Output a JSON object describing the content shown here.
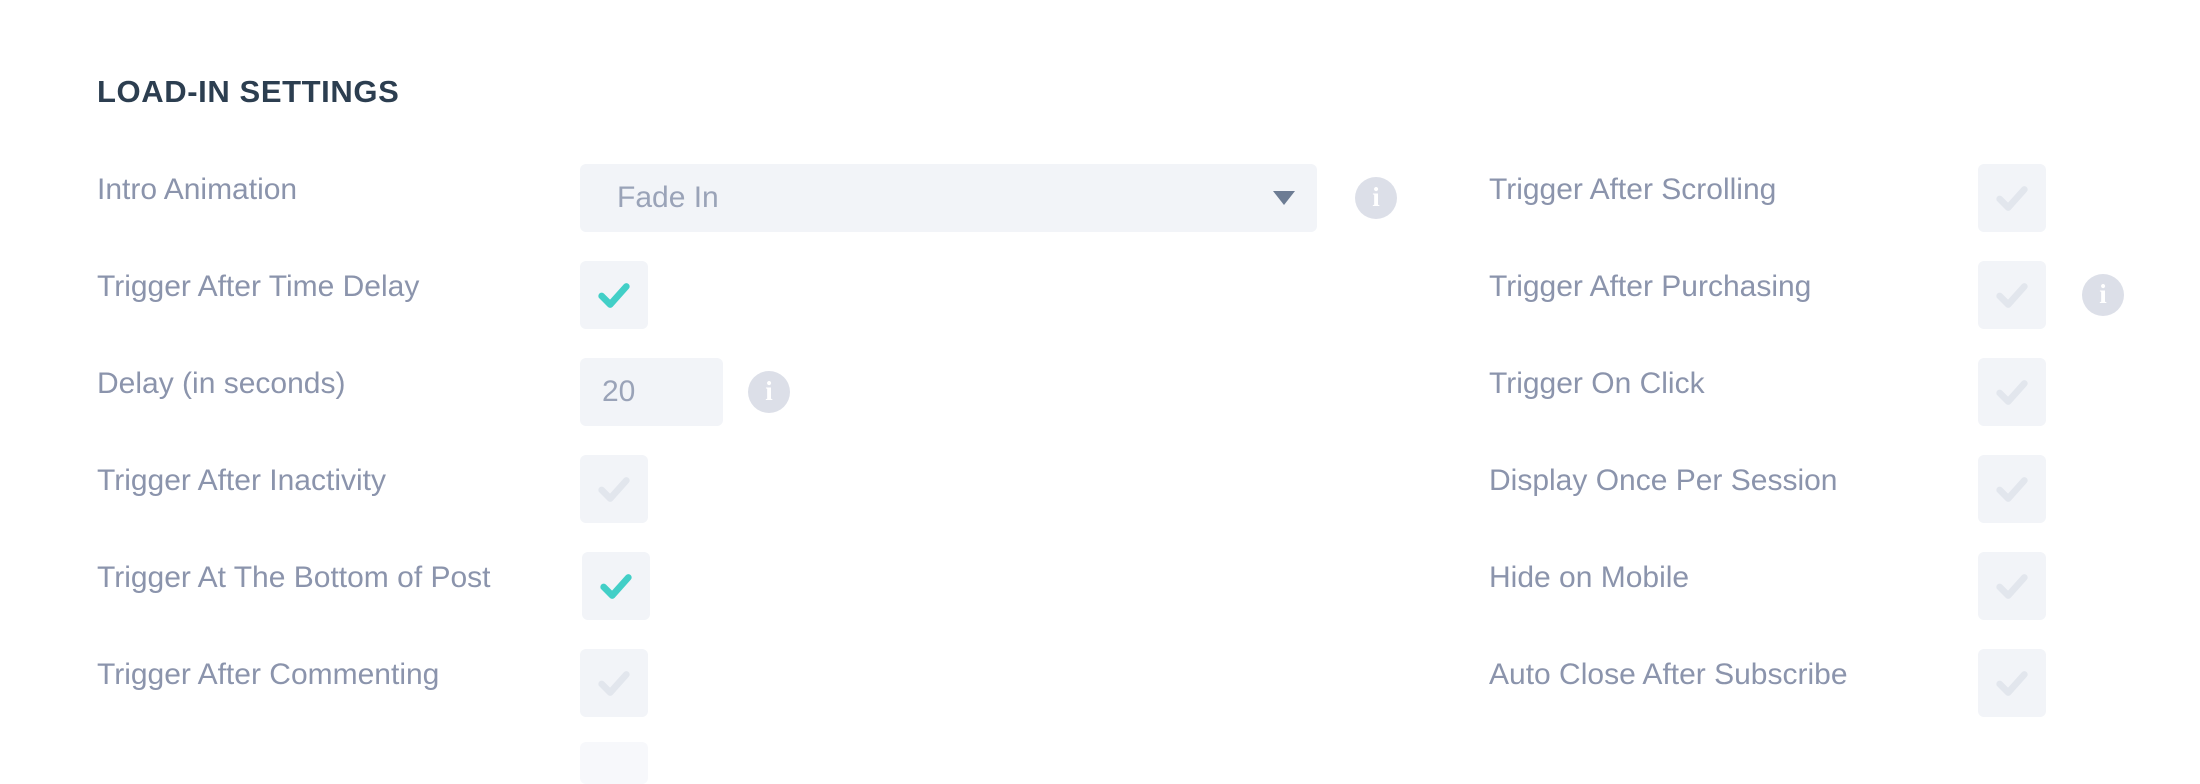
{
  "section": {
    "title": "LOAD-IN SETTINGS"
  },
  "colors": {
    "accent_check": "#42cfc7",
    "inactive_check": "#e2e6ed",
    "control_bg": "#f2f4f8",
    "label_text": "#8b94ac",
    "title_text": "#2c3e50",
    "info_icon_bg": "#dcdfe8"
  },
  "left_column": [
    {
      "label": "Intro Animation",
      "control": "select",
      "value": "Fade In",
      "has_info": true
    },
    {
      "label": "Trigger After Time Delay",
      "control": "checkbox",
      "checked": true,
      "has_info": false
    },
    {
      "label": "Delay (in seconds)",
      "control": "text",
      "value": "20",
      "has_info": true
    },
    {
      "label": "Trigger After Inactivity",
      "control": "checkbox",
      "checked": false,
      "has_info": false
    },
    {
      "label": "Trigger At The Bottom of Post",
      "control": "checkbox",
      "checked": true,
      "has_info": false
    },
    {
      "label": "Trigger After Commenting",
      "control": "checkbox",
      "checked": false,
      "has_info": false
    }
  ],
  "right_column": [
    {
      "label": "Trigger After Scrolling",
      "control": "checkbox",
      "checked": false,
      "has_info": false
    },
    {
      "label": "Trigger After Purchasing",
      "control": "checkbox",
      "checked": false,
      "has_info": true
    },
    {
      "label": "Trigger On Click",
      "control": "checkbox",
      "checked": false,
      "has_info": false
    },
    {
      "label": "Display Once Per Session",
      "control": "checkbox",
      "checked": false,
      "has_info": false
    },
    {
      "label": "Hide on Mobile",
      "control": "checkbox",
      "checked": false,
      "has_info": false
    },
    {
      "label": "Auto Close After Subscribe",
      "control": "checkbox",
      "checked": false,
      "has_info": false
    }
  ],
  "icons": {
    "info": "i",
    "dropdown": "chevron-down-icon",
    "check": "check-icon"
  }
}
